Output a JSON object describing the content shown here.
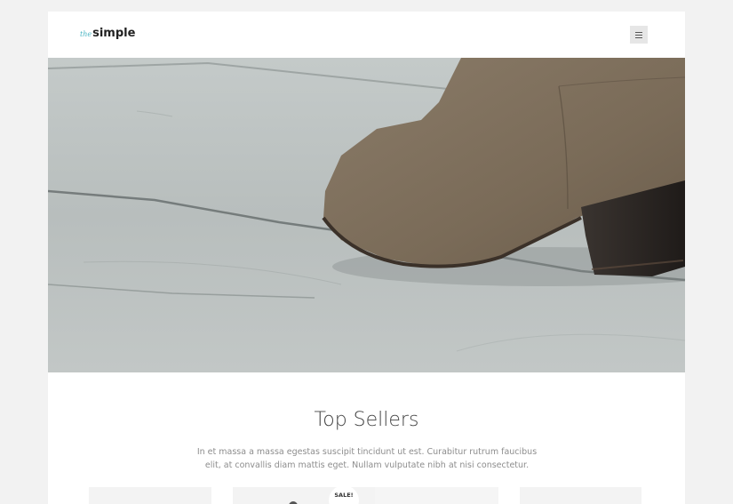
{
  "header": {
    "logo_prefix": "the",
    "logo_main": "simple",
    "menu_icon": "hamburger-icon"
  },
  "hero": {
    "image_subject": "suede ankle boot on white-painted wooden floor"
  },
  "section": {
    "title": "Top Sellers",
    "description": "In et massa a massa egestas suscipit tincidunt ut est. Curabitur rutrum faucibus elit, at convallis diam mattis eget. Nullam vulputate nibh at nisi consectetur."
  },
  "products": {
    "sale_badge": "SALE!"
  }
}
